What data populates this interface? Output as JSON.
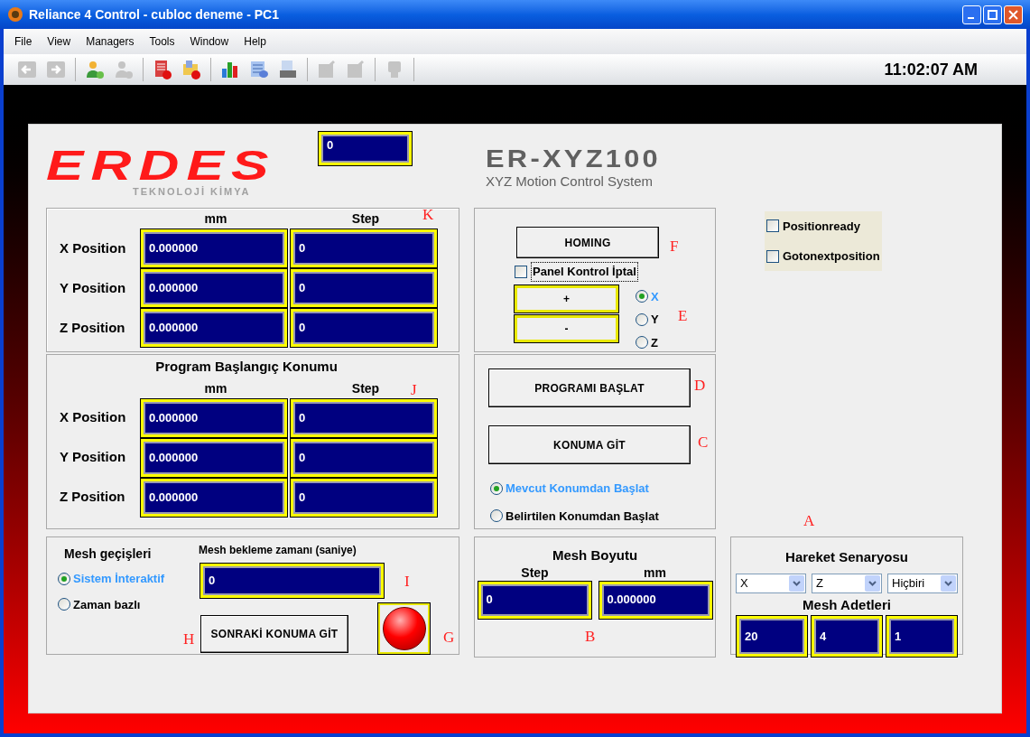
{
  "window": {
    "title": "Reliance 4 Control - cubloc deneme - PC1"
  },
  "menu": [
    "File",
    "View",
    "Managers",
    "Tools",
    "Window",
    "Help"
  ],
  "toolbar": [
    {
      "kind": "back",
      "disabled": true
    },
    {
      "kind": "forward",
      "disabled": true
    },
    {
      "kind": "sep"
    },
    {
      "kind": "user-add",
      "disabled": false
    },
    {
      "kind": "user-remove",
      "disabled": true
    },
    {
      "kind": "sep"
    },
    {
      "kind": "doc-alert",
      "disabled": false
    },
    {
      "kind": "folder-alert",
      "disabled": false
    },
    {
      "kind": "sep"
    },
    {
      "kind": "chart",
      "disabled": false
    },
    {
      "kind": "table",
      "disabled": false
    },
    {
      "kind": "print",
      "disabled": false
    },
    {
      "kind": "sep"
    },
    {
      "kind": "edit",
      "disabled": true
    },
    {
      "kind": "edit2",
      "disabled": true
    },
    {
      "kind": "sep"
    },
    {
      "kind": "terminal",
      "disabled": true
    },
    {
      "kind": "sep"
    }
  ],
  "clock": "11:02:07 AM",
  "header": {
    "logo": "ERDES",
    "logo_sub": "TEKNOLOJİ KİMYA",
    "top_value": "0",
    "product": "ER-XYZ100",
    "product_sub": "XYZ Motion Control System"
  },
  "current_position": {
    "annotation": "K",
    "columns": [
      "mm",
      "Step"
    ],
    "rows": [
      {
        "label": "X Position",
        "mm": "0.000000",
        "step": "0"
      },
      {
        "label": "Y Position",
        "mm": "0.000000",
        "step": "0"
      },
      {
        "label": "Z Position",
        "mm": "0.000000",
        "step": "0"
      }
    ]
  },
  "homing": {
    "button": "HOMING",
    "button_annotation": "F",
    "panel_checkbox": {
      "label": "Panel Kontrol İptal",
      "checked": false
    },
    "jog_buttons": [
      "+",
      "-"
    ],
    "axes": [
      {
        "label": "X",
        "selected": true
      },
      {
        "label": "Y",
        "selected": false
      },
      {
        "label": "Z",
        "selected": false
      }
    ],
    "axes_annotation": "E"
  },
  "status_flags": [
    {
      "label": "Positionready",
      "checked": false
    },
    {
      "label": "Gotonextposition",
      "checked": false
    }
  ],
  "program_start": {
    "title": "Program Başlangıç Konumu",
    "annotation": "J",
    "columns": [
      "mm",
      "Step"
    ],
    "rows": [
      {
        "label": "X Position",
        "mm": "0.000000",
        "step": "0"
      },
      {
        "label": "Y Position",
        "mm": "0.000000",
        "step": "0"
      },
      {
        "label": "Z Position",
        "mm": "0.000000",
        "step": "0"
      }
    ]
  },
  "program_controls": {
    "buttons": [
      {
        "label": "PROGRAMI BAŞLAT",
        "annotation": "D"
      },
      {
        "label": "KONUMA GİT",
        "annotation": "C"
      }
    ],
    "start_modes": [
      {
        "label": "Mevcut Konumdan Başlat",
        "selected": true
      },
      {
        "label": "Belirtilen Konumdan Başlat",
        "selected": false
      }
    ]
  },
  "mesh_transitions": {
    "title": "Mesh geçişleri",
    "modes": [
      {
        "label": "Sistem İnteraktif",
        "selected": true
      },
      {
        "label": "Zaman bazlı",
        "selected": false
      }
    ],
    "wait_label": "Mesh bekleme zamanı (saniye)",
    "wait_value": "0",
    "wait_annotation": "I",
    "next_button": "SONRAKİ KONUMA GİT",
    "next_annotation": "H",
    "lamp": {
      "lit": true,
      "annotation": "G"
    }
  },
  "mesh_size": {
    "title": "Mesh Boyutu",
    "columns": [
      "Step",
      "mm"
    ],
    "values": [
      "0",
      "0.000000"
    ],
    "annotation": "B"
  },
  "scenario": {
    "annotation": "A",
    "title": "Hareket Senaryosu",
    "selects": [
      "X",
      "Z",
      "Hiçbiri"
    ],
    "counts_title": "Mesh Adetleri",
    "counts": [
      "20",
      "4",
      "1"
    ]
  }
}
